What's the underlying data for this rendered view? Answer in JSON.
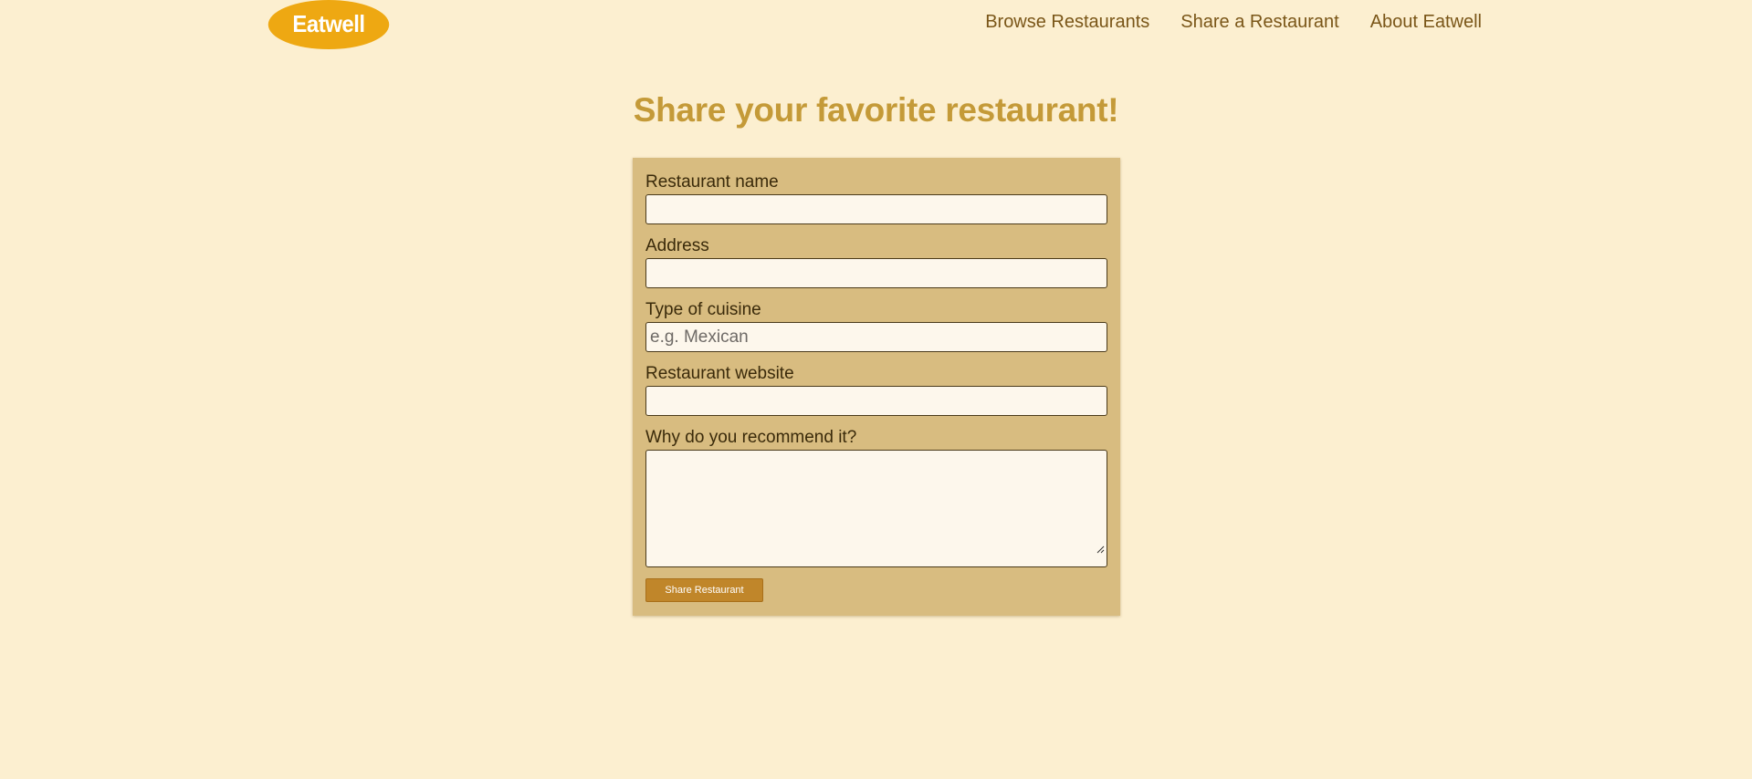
{
  "header": {
    "logo_text": "Eatwell",
    "nav": [
      {
        "label": "Browse Restaurants"
      },
      {
        "label": "Share a Restaurant"
      },
      {
        "label": "About Eatwell"
      }
    ]
  },
  "main": {
    "title": "Share your favorite restaurant!"
  },
  "form": {
    "fields": {
      "name": {
        "label": "Restaurant name",
        "value": "",
        "placeholder": ""
      },
      "address": {
        "label": "Address",
        "value": "",
        "placeholder": ""
      },
      "cuisine": {
        "label": "Type of cuisine",
        "value": "",
        "placeholder": "e.g. Mexican"
      },
      "website": {
        "label": "Restaurant website",
        "value": "",
        "placeholder": ""
      },
      "recommend": {
        "label": "Why do you recommend it?",
        "value": ""
      }
    },
    "submit_label": "Share Restaurant"
  },
  "colors": {
    "background": "#fcefd0",
    "logo": "#eea812",
    "title": "#c49a38",
    "card": "#d8bc80",
    "button": "#c0862a",
    "nav_text": "#7a5618"
  }
}
